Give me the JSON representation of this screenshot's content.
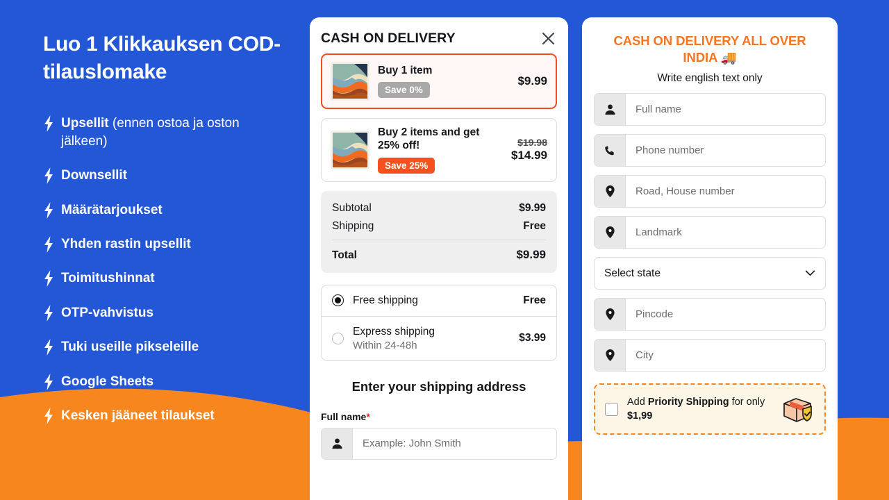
{
  "theme": {
    "brand_blue": "#2457d6",
    "brand_orange": "#f7861f",
    "accent_red": "#f04a23",
    "card_white": "#ffffff"
  },
  "promo": {
    "title": "Luo 1 Klikkauksen COD-tilauslomake",
    "features": [
      {
        "bold": "Upsellit",
        "rest": " (ennen ostoa ja oston jälkeen)"
      },
      {
        "bold": "Downsellit",
        "rest": ""
      },
      {
        "bold": "Määrätarjoukset",
        "rest": ""
      },
      {
        "bold": "Yhden rastin upsellit",
        "rest": ""
      },
      {
        "bold": "Toimitushinnat",
        "rest": ""
      },
      {
        "bold": "OTP-vahvistus",
        "rest": ""
      },
      {
        "bold": "Tuki useille pikseleille",
        "rest": ""
      },
      {
        "bold": "Google Sheets",
        "rest": ""
      },
      {
        "bold": "Kesken jääneet tilaukset",
        "rest": ""
      }
    ]
  },
  "cart": {
    "title": "CASH ON DELIVERY",
    "close_icon": "close-icon",
    "offers": [
      {
        "name": "Buy 1 item",
        "badge": "Save 0%",
        "badge_style": "gray",
        "price": "$9.99",
        "old_price": "",
        "selected": true
      },
      {
        "name": "Buy 2 items and get 25% off!",
        "badge": "Save 25%",
        "badge_style": "orange",
        "price": "$14.99",
        "old_price": "$19.98",
        "selected": false
      }
    ],
    "totals": [
      {
        "label": "Subtotal",
        "value": "$9.99"
      },
      {
        "label": "Shipping",
        "value": "Free"
      }
    ],
    "grand_total": {
      "label": "Total",
      "value": "$9.99"
    },
    "shipping_methods": [
      {
        "name": "Free shipping",
        "sub": "",
        "price": "Free",
        "selected": true
      },
      {
        "name": "Express shipping",
        "sub": "Within 24-48h",
        "price": "$3.99",
        "selected": false
      }
    ],
    "address_title": "Enter your shipping address",
    "fullname_label": "Full name",
    "fullname_required_mark": "*",
    "fullname_placeholder": "Example: John Smith"
  },
  "form": {
    "title": "CASH ON DELIVERY ALL OVER INDIA 🚚",
    "subtitle": "Write english text only",
    "fields": [
      {
        "placeholder": "Full name",
        "icon": "person-icon"
      },
      {
        "placeholder": "Phone number",
        "icon": "phone-icon"
      },
      {
        "placeholder": "Road, House number",
        "icon": "location-pin-icon"
      },
      {
        "placeholder": "Landmark",
        "icon": "location-pin-icon"
      }
    ],
    "state_select": {
      "value": "Select state",
      "icon": "chevron-down-icon"
    },
    "fields2": [
      {
        "placeholder": "Pincode",
        "icon": "location-pin-icon"
      },
      {
        "placeholder": "City",
        "icon": "location-pin-icon"
      }
    ],
    "priority": {
      "prefix": "Add ",
      "bold1": "Priority Shipping",
      "middle": " for only ",
      "bold2": "$1,99",
      "icon": "package-shield-icon"
    }
  }
}
